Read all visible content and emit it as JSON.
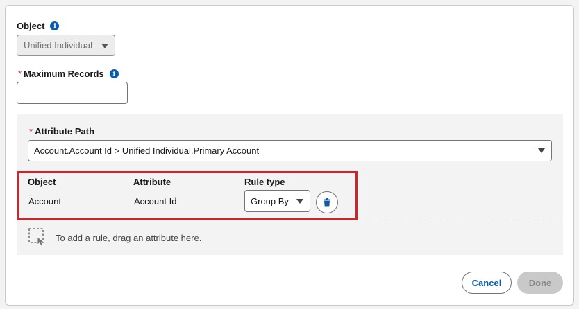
{
  "object_field": {
    "label": "Object",
    "info_icon": "info-icon",
    "value": "Unified Individual"
  },
  "max_records": {
    "required_mark": "*",
    "label": "Maximum Records",
    "info_icon": "info-icon",
    "value": ""
  },
  "attribute_path": {
    "required_mark": "*",
    "label": "Attribute Path",
    "value": "Account.Account Id > Unified Individual.Primary Account"
  },
  "rules_table": {
    "headers": [
      "Object",
      "Attribute",
      "Rule type"
    ],
    "rows": [
      {
        "object": "Account",
        "attribute": "Account Id",
        "rule_type": "Group By",
        "delete_icon": "trash-icon"
      }
    ]
  },
  "drop_zone": {
    "icon": "drag-hand-icon",
    "hint": "To add a rule, drag an attribute here."
  },
  "footer": {
    "cancel_label": "Cancel",
    "done_label": "Done"
  },
  "colors": {
    "brand_blue": "#0b5cab",
    "required_red": "#c23934",
    "highlight_red": "#d1232a",
    "disabled_gray": "#c9c9c9"
  }
}
